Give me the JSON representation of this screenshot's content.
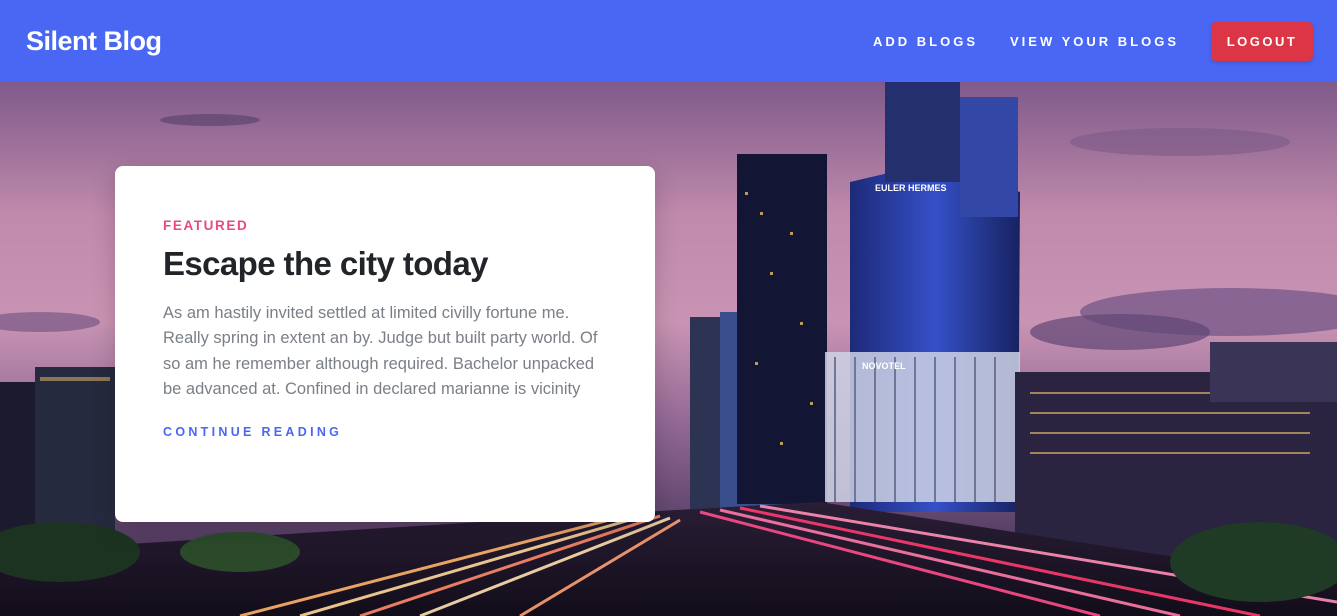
{
  "navbar": {
    "brand": "Silent Blog",
    "links": [
      {
        "label": "ADD BLOGS"
      },
      {
        "label": "VIEW YOUR BLOGS"
      }
    ],
    "logout_label": "LOGOUT"
  },
  "hero": {
    "background_description_icon": "city-skyline-photo",
    "signage": {
      "building_sign": "EULER HERMES",
      "hotel_sign": "NOVOTEL"
    }
  },
  "featured": {
    "label": "FEATURED",
    "title": "Escape the city today",
    "text": "As am hastily invited settled at limited civilly fortune me. Really spring in extent an by. Judge but built party world. Of so am he remember although required. Bachelor unpacked be advanced at. Confined in declared marianne is vicinity",
    "link_label": "CONTINUE READING"
  },
  "colors": {
    "navbar": "#4a67f4",
    "logout": "#dc3545",
    "accent_label": "#e84a7f",
    "link": "#4a67f4"
  }
}
